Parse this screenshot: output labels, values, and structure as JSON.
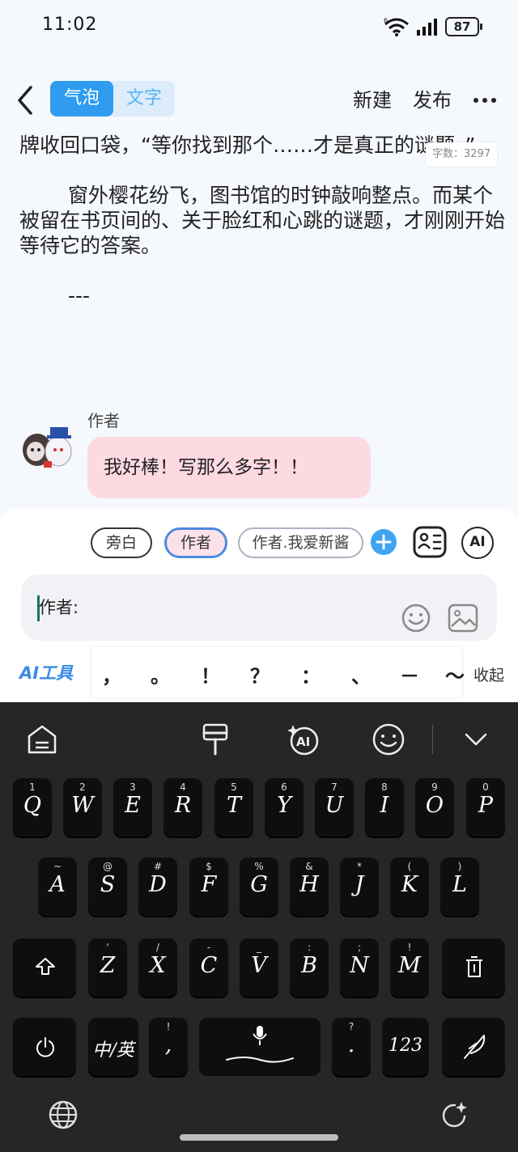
{
  "status": {
    "time": "11:02",
    "battery": "87"
  },
  "header": {
    "seg_bubble": "气泡",
    "seg_text": "文字",
    "new_label": "新建",
    "publish_label": "发布"
  },
  "article": {
    "para1": "牌收回口袋，“等你找到那个……才是真正的谜题。”",
    "para2": "窗外樱花纷飞，图书馆的时钟敲响整点。而某个被留在书页间的、关于脸红和心跳的谜题，才刚刚开始等待它的答案。",
    "separator": "---",
    "word_count": "字数：3297"
  },
  "message": {
    "author": "作者",
    "text": "我好棒！写那么多字！！"
  },
  "panel": {
    "chips": [
      "旁白",
      "作者",
      "作者.我爱新酱"
    ],
    "ai_badge": "AI",
    "input_value": "作者:",
    "ai_tools_label": "AI工具",
    "punctuation": [
      "，",
      "。",
      "！",
      "？",
      "：",
      "、",
      "－",
      "～"
    ],
    "collapse_label": "收起"
  },
  "keyboard": {
    "row1": [
      {
        "hint": "1",
        "key": "Q"
      },
      {
        "hint": "2",
        "key": "W"
      },
      {
        "hint": "3",
        "key": "E"
      },
      {
        "hint": "4",
        "key": "R"
      },
      {
        "hint": "5",
        "key": "T"
      },
      {
        "hint": "6",
        "key": "Y"
      },
      {
        "hint": "7",
        "key": "U"
      },
      {
        "hint": "8",
        "key": "I"
      },
      {
        "hint": "9",
        "key": "O"
      },
      {
        "hint": "0",
        "key": "P"
      }
    ],
    "row2": [
      {
        "hint": "~",
        "key": "A"
      },
      {
        "hint": "@",
        "key": "S"
      },
      {
        "hint": "#",
        "key": "D"
      },
      {
        "hint": "$",
        "key": "F"
      },
      {
        "hint": "%",
        "key": "G"
      },
      {
        "hint": "&",
        "key": "H"
      },
      {
        "hint": "*",
        "key": "J"
      },
      {
        "hint": "(",
        "key": "K"
      },
      {
        "hint": ")",
        "key": "L"
      }
    ],
    "row3": [
      {
        "hint": "'",
        "key": "Z"
      },
      {
        "hint": "/",
        "key": "X"
      },
      {
        "hint": "-",
        "key": "C"
      },
      {
        "hint": "_",
        "key": "V"
      },
      {
        "hint": ":",
        "key": "B"
      },
      {
        "hint": ";",
        "key": "N"
      },
      {
        "hint": "!",
        "key": "M"
      }
    ],
    "lang_key": "中/英",
    "comma_hint": "!",
    "comma_key": ",",
    "period_hint": "?",
    "period_key": ".",
    "num_key": "123"
  }
}
